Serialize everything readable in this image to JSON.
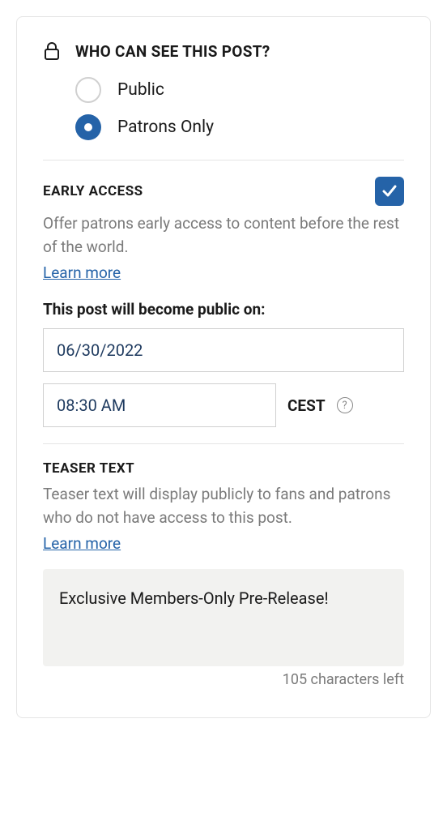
{
  "visibility": {
    "title": "WHO CAN SEE THIS POST?",
    "options": {
      "public": "Public",
      "patrons": "Patrons Only"
    },
    "selected": "patrons"
  },
  "earlyAccess": {
    "title": "EARLY ACCESS",
    "enabled": true,
    "description": "Offer patrons early access to content before the rest of the world.",
    "learnMore": "Learn more",
    "publicOnLabel": "This post will become public on:",
    "date": "06/30/2022",
    "time": "08:30 AM",
    "timezone": "CEST"
  },
  "teaser": {
    "title": "TEASER TEXT",
    "description": "Teaser text will display publicly to fans and patrons who do not have access to this post.",
    "learnMore": "Learn more",
    "text": "Exclusive Members-Only Pre-Release!",
    "charsLeft": "105 characters left"
  }
}
